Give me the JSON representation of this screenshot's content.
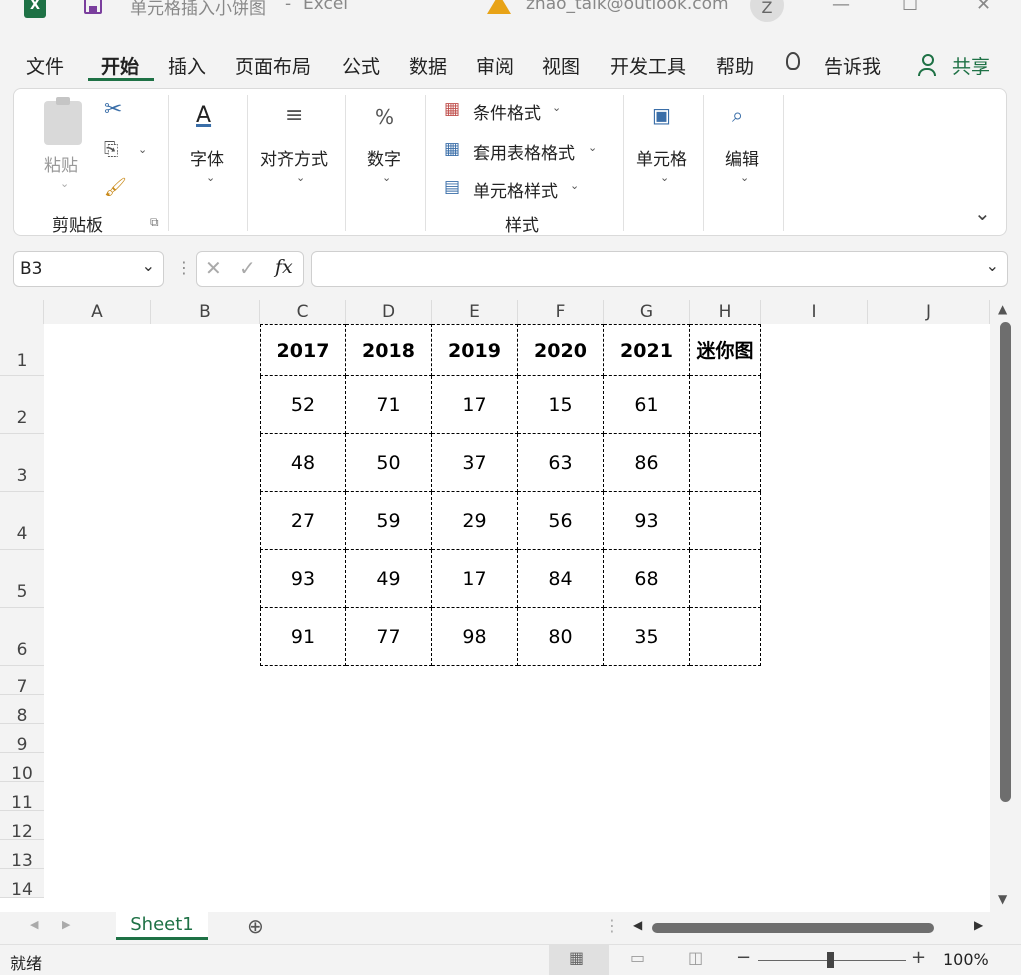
{
  "titlebar": {
    "file_name": "单元格插入小饼图",
    "separator": "-",
    "app": "Excel",
    "account": "zhao_talk@outlook.com",
    "avatar_letter": "Z",
    "minimize": "—",
    "maximize": "☐",
    "close": "✕"
  },
  "ribbon_tabs": [
    "文件",
    "开始",
    "插入",
    "页面布局",
    "公式",
    "数据",
    "审阅",
    "视图",
    "开发工具",
    "帮助",
    "告诉我"
  ],
  "share_label": "共享",
  "ribbon": {
    "paste": "粘贴",
    "clipboard_group": "剪贴板",
    "font": "字体",
    "alignment": "对齐方式",
    "number": "数字",
    "percent_symbol": "%",
    "conditional_format": "条件格式",
    "table_format": "套用表格格式",
    "cell_style": "单元格样式",
    "styles_group": "样式",
    "cells": "单元格",
    "editing": "编辑"
  },
  "formula_bar": {
    "name_box": "B3",
    "fx": "fx",
    "content": ""
  },
  "sheet": {
    "columns": [
      "A",
      "B",
      "C",
      "D",
      "E",
      "F",
      "G",
      "H",
      "I",
      "J"
    ],
    "rows": [
      "1",
      "2",
      "3",
      "4",
      "5",
      "6",
      "7",
      "8",
      "9",
      "10",
      "11",
      "12",
      "13",
      "14"
    ],
    "header_row": [
      "2017",
      "2018",
      "2019",
      "2020",
      "2021",
      "迷你图"
    ],
    "data": [
      [
        "52",
        "71",
        "17",
        "15",
        "61",
        ""
      ],
      [
        "48",
        "50",
        "37",
        "63",
        "86",
        ""
      ],
      [
        "27",
        "59",
        "29",
        "56",
        "93",
        ""
      ],
      [
        "93",
        "49",
        "17",
        "84",
        "68",
        ""
      ],
      [
        "91",
        "77",
        "98",
        "80",
        "35",
        ""
      ]
    ]
  },
  "sheet_tab": "Sheet1",
  "status": {
    "ready": "就绪",
    "zoom": "100%"
  },
  "colors": {
    "excel_green": "#1e7145",
    "accent_purple": "#7a3e9d",
    "warning": "#e8a317"
  }
}
